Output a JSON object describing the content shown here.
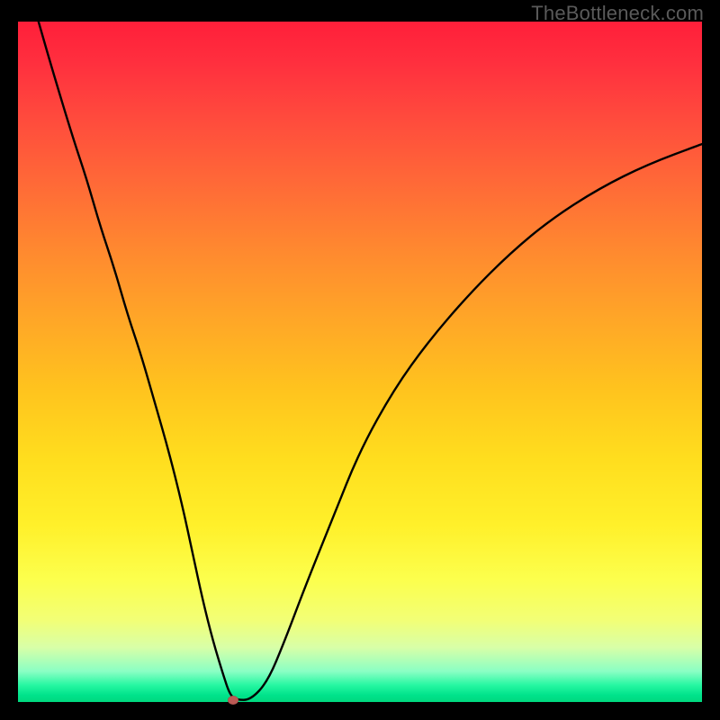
{
  "watermark": "TheBottleneck.com",
  "chart_data": {
    "type": "line",
    "title": "",
    "xlabel": "",
    "ylabel": "",
    "xlim": [
      0,
      100
    ],
    "ylim": [
      0,
      100
    ],
    "series": [
      {
        "name": "bottleneck-curve",
        "x": [
          3,
          5,
          8,
          10,
          12,
          14,
          16,
          18,
          20,
          22,
          24,
          25.5,
          27,
          28.5,
          30,
          31,
          32,
          34,
          36.5,
          39,
          42,
          46,
          50,
          55,
          60,
          66,
          72,
          78,
          85,
          92,
          100
        ],
        "y": [
          100,
          93,
          83,
          77,
          70,
          64,
          57,
          51,
          44,
          37,
          29,
          22,
          15,
          9,
          4,
          1,
          0.3,
          0.3,
          3,
          9,
          17,
          27,
          37,
          46,
          53,
          60,
          66,
          71,
          75.5,
          79,
          82
        ]
      }
    ],
    "marker": {
      "x": 31.5,
      "y": 0.2,
      "color": "#bb5a55"
    },
    "gradient_stops": [
      {
        "pos": 0,
        "color": "#ff1f3a"
      },
      {
        "pos": 0.5,
        "color": "#ffc31e"
      },
      {
        "pos": 0.82,
        "color": "#fcff4d"
      },
      {
        "pos": 1.0,
        "color": "#00d87e"
      }
    ]
  }
}
